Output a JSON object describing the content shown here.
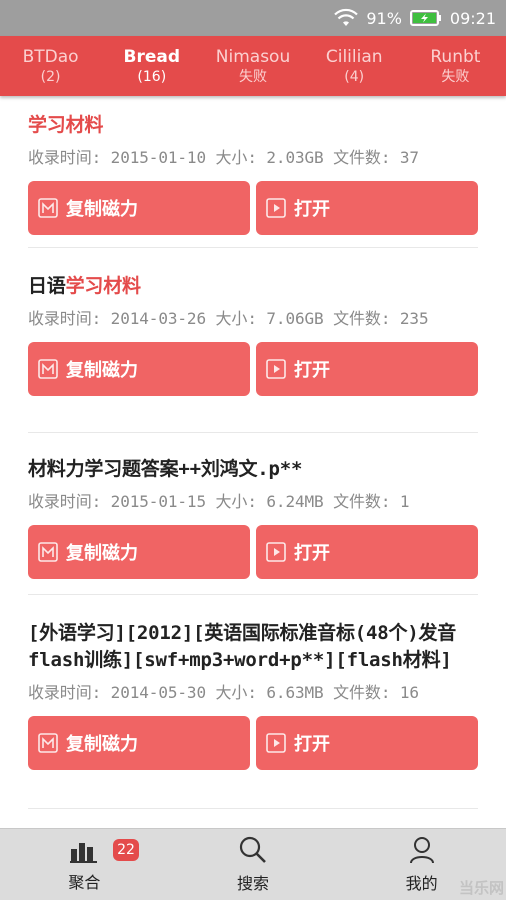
{
  "status_bar": {
    "battery": "91%",
    "time": "09:21"
  },
  "tabs": [
    {
      "name": "BTDao",
      "sub": "(2)",
      "active": false
    },
    {
      "name": "Bread",
      "sub": "(16)",
      "active": true
    },
    {
      "name": "Nimasou",
      "sub": "失败",
      "active": false
    },
    {
      "name": "Cililian",
      "sub": "(4)",
      "active": false
    },
    {
      "name": "Runbt",
      "sub": "失败",
      "active": false
    }
  ],
  "buttons": {
    "copy_magnet": "复制磁力",
    "open": "打开"
  },
  "results": [
    {
      "title_pre": "",
      "title_hl": "学习材料",
      "title_post": "",
      "meta": "收录时间: 2015-01-10 大小: 2.03GB 文件数: 37"
    },
    {
      "title_pre": "日语",
      "title_hl": "学习材料",
      "title_post": "",
      "meta": "收录时间: 2014-03-26 大小: 7.06GB 文件数: 235"
    },
    {
      "title_pre": "材料力学习题答案++刘鸿文.p**",
      "title_hl": "",
      "title_post": "",
      "meta": "收录时间: 2015-01-15 大小: 6.24MB 文件数: 1"
    },
    {
      "title_pre": "[外语学习][2012][英语国际标准音标(48个)发音flash训练][swf+mp3+word+p**][flash材料]",
      "title_hl": "",
      "title_post": "",
      "meta": "收录时间: 2014-05-30 大小: 6.63MB 文件数: 16"
    }
  ],
  "bottom_nav": {
    "aggregate": "聚合",
    "aggregate_badge": "22",
    "search": "搜索",
    "mine": "我的"
  },
  "watermark": "当乐网"
}
